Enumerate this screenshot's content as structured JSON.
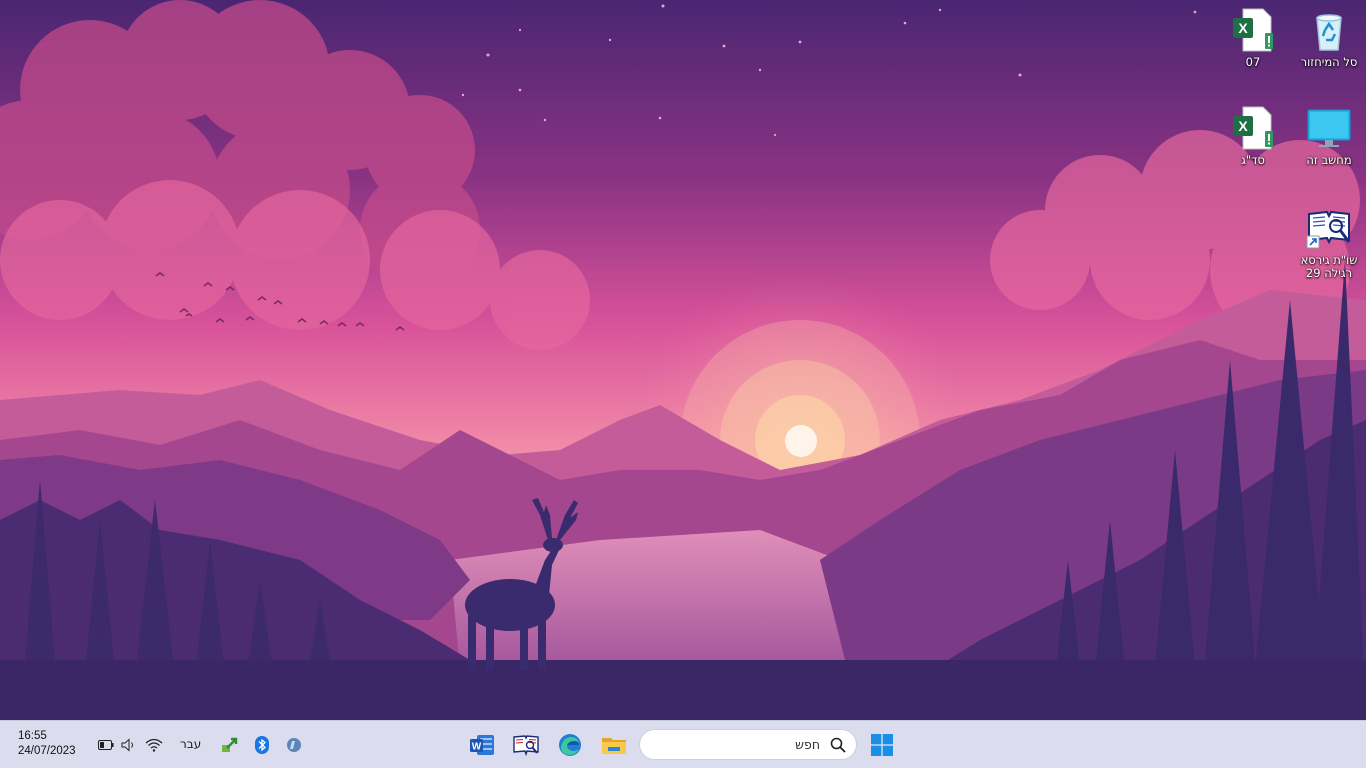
{
  "desktop": {
    "icons": [
      {
        "label": "סל המיחזור",
        "icon": "recycle-bin-icon"
      },
      {
        "label": "07",
        "icon": "excel-file-icon"
      },
      {
        "label": "מחשב זה",
        "icon": "this-pc-monitor-icon"
      },
      {
        "label": "סד\"ג",
        "icon": "excel-file-icon"
      },
      {
        "label": "שו\"ת גירסא רגילה 29",
        "icon": "book-shortcut-icon"
      }
    ]
  },
  "taskbar": {
    "clock_time": "16:55",
    "clock_date": "24/07/2023",
    "language": "עבר",
    "search_placeholder": "חפש",
    "tray_icons": [
      "battery-icon",
      "volume-icon",
      "wifi-icon",
      "green-arrow-app-icon",
      "bluetooth-icon",
      "globe-app-icon"
    ],
    "pinned_apps": [
      "word-icon",
      "book-app-icon",
      "edge-icon",
      "file-explorer-icon"
    ],
    "start": "windows-start-icon"
  },
  "colors": {
    "taskbar_bg": "#dcdcef",
    "sky_top": "#5b2a78",
    "sky_mid": "#d9549a",
    "horizon": "#f7a9a8",
    "foreground": "#3b2766"
  }
}
